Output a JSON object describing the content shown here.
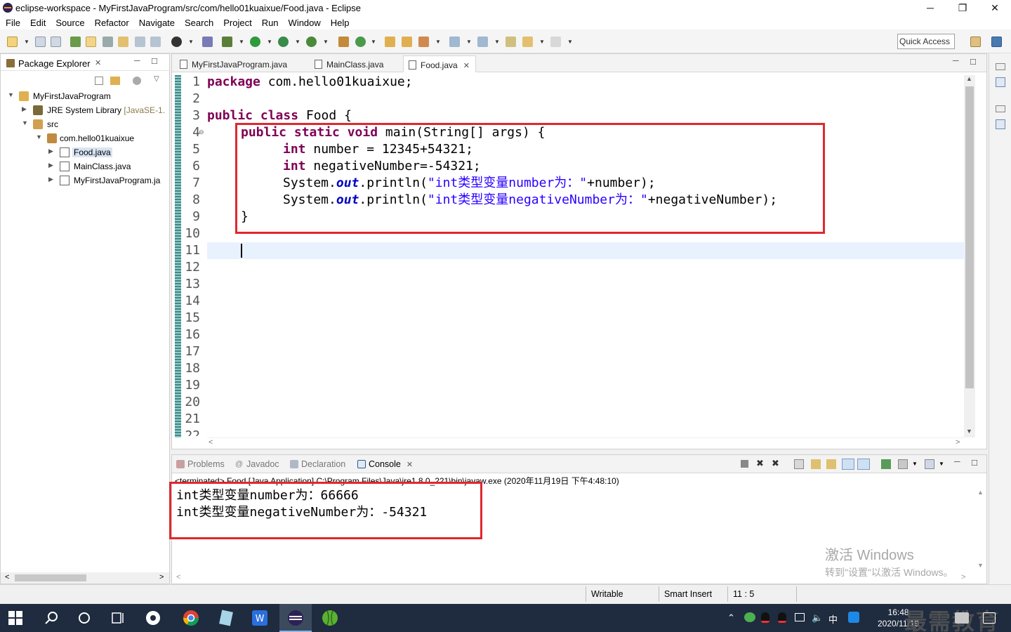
{
  "window": {
    "title": "eclipse-workspace - MyFirstJavaProgram/src/com/hello01kuaixue/Food.java - Eclipse",
    "minimize": "─",
    "maximize": "❐",
    "close": "✕"
  },
  "menu": [
    "File",
    "Edit",
    "Source",
    "Refactor",
    "Navigate",
    "Search",
    "Project",
    "Run",
    "Window",
    "Help"
  ],
  "toolbar": {
    "quick_access": "Quick Access"
  },
  "package_explorer": {
    "title": "Package Explorer",
    "items": [
      {
        "label": "MyFirstJavaProgram",
        "suffix": ""
      },
      {
        "label": "JRE System Library",
        "suffix": "[JavaSE-1."
      },
      {
        "label": "src",
        "suffix": ""
      },
      {
        "label": "com.hello01kuaixue",
        "suffix": ""
      },
      {
        "label": "Food.java",
        "suffix": ""
      },
      {
        "label": "MainClass.java",
        "suffix": ""
      },
      {
        "label": "MyFirstJavaProgram.ja",
        "suffix": ""
      }
    ]
  },
  "editor": {
    "tabs": [
      {
        "label": "MyFirstJavaProgram.java"
      },
      {
        "label": "MainClass.java"
      },
      {
        "label": "Food.java",
        "close": "✕"
      }
    ],
    "line_numbers": [
      "1",
      "2",
      "3",
      "4",
      "5",
      "6",
      "7",
      "8",
      "9",
      "10",
      "11",
      "12",
      "13",
      "14",
      "15",
      "16",
      "17",
      "18",
      "19",
      "20",
      "21",
      "22"
    ],
    "code": {
      "l1_kw": "package",
      "l1_rest": " com.hello01kuaixue;",
      "l3_kw": "public class",
      "l3_rest": " Food {",
      "l4_kw": "public static void",
      "l4_rest": " main(String[] args) {",
      "l5_kw": "int",
      "l5_rest": " number = 12345+54321;",
      "l6_kw": "int",
      "l6_rest": " negativeNumber=-54321;",
      "l7_a": "System.",
      "l7_fld": "out",
      "l7_b": ".println(",
      "l7_str": "\"int类型变量number为：\"",
      "l7_c": "+number);",
      "l8_a": "System.",
      "l8_fld": "out",
      "l8_b": ".println(",
      "l8_str": "\"int类型变量negativeNumber为：\"",
      "l8_c": "+negativeNumber);",
      "l9": "}"
    }
  },
  "console": {
    "tabs": [
      "Problems",
      "Javadoc",
      "Declaration",
      "Console"
    ],
    "close": "✕",
    "status": "<terminated> Food [Java Application] C:\\Program Files\\Java\\jre1.8.0_221\\bin\\javaw.exe (2020年11月19日 下午4:48:10)",
    "output": [
      "int类型变量number为：66666",
      "int类型变量negativeNumber为：-54321"
    ],
    "watermark_title": "激活 Windows",
    "watermark_sub": "转到\"设置\"以激活 Windows。"
  },
  "statusbar": {
    "writable": "Writable",
    "insert_mode": "Smart Insert",
    "position": "11 : 5"
  },
  "taskbar": {
    "time": "16:48",
    "date": "2020/11/19",
    "brand": "最需教育",
    "ime": "中"
  },
  "colors": {
    "highlight_box": "#e0282e",
    "keyword": "#7f0055",
    "string": "#2a00ff",
    "field": "#0000c0",
    "taskbar": "#1f2b3e"
  }
}
